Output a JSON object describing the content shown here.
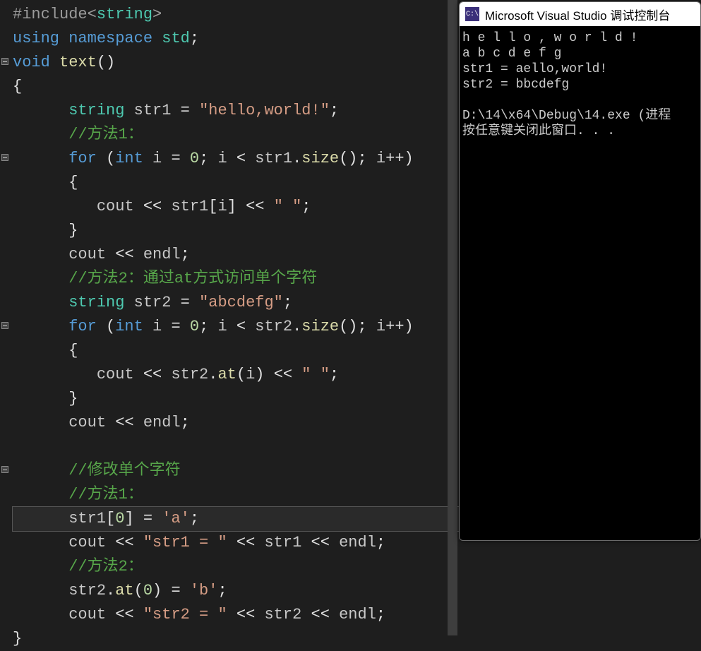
{
  "editor": {
    "lines": [
      {
        "indent": 0,
        "tokens": [
          [
            "pp",
            "#include"
          ],
          [
            "pp",
            "<"
          ],
          [
            "cls",
            "string"
          ],
          [
            "pp",
            ">"
          ]
        ]
      },
      {
        "indent": 0,
        "tokens": [
          [
            "kw",
            "using"
          ],
          [
            "var",
            " "
          ],
          [
            "kw",
            "namespace"
          ],
          [
            "var",
            " "
          ],
          [
            "cls",
            "std"
          ],
          [
            "pun",
            ";"
          ]
        ]
      },
      {
        "indent": 0,
        "fold": true,
        "tokens": [
          [
            "kw",
            "void"
          ],
          [
            "var",
            " "
          ],
          [
            "fn",
            "text"
          ],
          [
            "pun",
            "()"
          ]
        ]
      },
      {
        "indent": 0,
        "tokens": [
          [
            "pun",
            "{"
          ]
        ]
      },
      {
        "indent": 2,
        "tokens": [
          [
            "cls",
            "string"
          ],
          [
            "var",
            " str1 "
          ],
          [
            "pun",
            "= "
          ],
          [
            "str",
            "\"hello,world!\""
          ],
          [
            "pun",
            ";"
          ]
        ]
      },
      {
        "indent": 2,
        "tokens": [
          [
            "cmt",
            "//方法1："
          ]
        ]
      },
      {
        "indent": 2,
        "fold": true,
        "tokens": [
          [
            "kw",
            "for"
          ],
          [
            "pun",
            " ("
          ],
          [
            "kw",
            "int"
          ],
          [
            "var",
            " i "
          ],
          [
            "pun",
            "= "
          ],
          [
            "num",
            "0"
          ],
          [
            "pun",
            "; "
          ],
          [
            "var",
            "i "
          ],
          [
            "pun",
            "< "
          ],
          [
            "var",
            "str1"
          ],
          [
            "pun",
            "."
          ],
          [
            "fn",
            "size"
          ],
          [
            "pun",
            "(); "
          ],
          [
            "var",
            "i"
          ],
          [
            "pun",
            "++)"
          ]
        ]
      },
      {
        "indent": 2,
        "tokens": [
          [
            "pun",
            "{"
          ]
        ]
      },
      {
        "indent": 3,
        "tokens": [
          [
            "var",
            "cout "
          ],
          [
            "pun",
            "<< "
          ],
          [
            "var",
            "str1"
          ],
          [
            "pun",
            "["
          ],
          [
            "var",
            "i"
          ],
          [
            "pun",
            "] "
          ],
          [
            "pun",
            "<< "
          ],
          [
            "str",
            "\" \""
          ],
          [
            "pun",
            ";"
          ]
        ]
      },
      {
        "indent": 2,
        "tokens": [
          [
            "pun",
            "}"
          ]
        ]
      },
      {
        "indent": 2,
        "tokens": [
          [
            "var",
            "cout "
          ],
          [
            "pun",
            "<< "
          ],
          [
            "var",
            "endl"
          ],
          [
            "pun",
            ";"
          ]
        ]
      },
      {
        "indent": 2,
        "tokens": [
          [
            "cmt",
            "//方法2：通过at方式访问单个字符"
          ]
        ]
      },
      {
        "indent": 2,
        "tokens": [
          [
            "cls",
            "string"
          ],
          [
            "var",
            " str2 "
          ],
          [
            "pun",
            "= "
          ],
          [
            "str",
            "\"abcdefg\""
          ],
          [
            "pun",
            ";"
          ]
        ]
      },
      {
        "indent": 2,
        "fold": true,
        "tokens": [
          [
            "kw",
            "for"
          ],
          [
            "pun",
            " ("
          ],
          [
            "kw",
            "int"
          ],
          [
            "var",
            " i "
          ],
          [
            "pun",
            "= "
          ],
          [
            "num",
            "0"
          ],
          [
            "pun",
            "; "
          ],
          [
            "var",
            "i "
          ],
          [
            "pun",
            "< "
          ],
          [
            "var",
            "str2"
          ],
          [
            "pun",
            "."
          ],
          [
            "fn",
            "size"
          ],
          [
            "pun",
            "(); "
          ],
          [
            "var",
            "i"
          ],
          [
            "pun",
            "++)"
          ]
        ]
      },
      {
        "indent": 2,
        "tokens": [
          [
            "pun",
            "{"
          ]
        ]
      },
      {
        "indent": 3,
        "tokens": [
          [
            "var",
            "cout "
          ],
          [
            "pun",
            "<< "
          ],
          [
            "var",
            "str2"
          ],
          [
            "pun",
            "."
          ],
          [
            "fn",
            "at"
          ],
          [
            "pun",
            "("
          ],
          [
            "var",
            "i"
          ],
          [
            "pun",
            ") "
          ],
          [
            "pun",
            "<< "
          ],
          [
            "str",
            "\" \""
          ],
          [
            "pun",
            ";"
          ]
        ]
      },
      {
        "indent": 2,
        "tokens": [
          [
            "pun",
            "}"
          ]
        ]
      },
      {
        "indent": 2,
        "tokens": [
          [
            "var",
            "cout "
          ],
          [
            "pun",
            "<< "
          ],
          [
            "var",
            "endl"
          ],
          [
            "pun",
            ";"
          ]
        ]
      },
      {
        "indent": 0,
        "tokens": []
      },
      {
        "indent": 2,
        "fold": true,
        "tokens": [
          [
            "cmt",
            "//修改单个字符"
          ]
        ]
      },
      {
        "indent": 2,
        "tokens": [
          [
            "cmt",
            "//方法1："
          ]
        ]
      },
      {
        "indent": 2,
        "hl": true,
        "tokens": [
          [
            "var",
            "str1"
          ],
          [
            "pun",
            "["
          ],
          [
            "num",
            "0"
          ],
          [
            "pun",
            "] "
          ],
          [
            "pun",
            "= "
          ],
          [
            "str",
            "'a'"
          ],
          [
            "pun",
            ";"
          ]
        ]
      },
      {
        "indent": 2,
        "tokens": [
          [
            "var",
            "cout "
          ],
          [
            "pun",
            "<< "
          ],
          [
            "str",
            "\"str1 = \""
          ],
          [
            "pun",
            " << "
          ],
          [
            "var",
            "str1"
          ],
          [
            "pun",
            " << "
          ],
          [
            "var",
            "endl"
          ],
          [
            "pun",
            ";"
          ]
        ]
      },
      {
        "indent": 2,
        "tokens": [
          [
            "cmt",
            "//方法2："
          ]
        ]
      },
      {
        "indent": 2,
        "tokens": [
          [
            "var",
            "str2"
          ],
          [
            "pun",
            "."
          ],
          [
            "fn",
            "at"
          ],
          [
            "pun",
            "("
          ],
          [
            "num",
            "0"
          ],
          [
            "pun",
            ") "
          ],
          [
            "pun",
            "= "
          ],
          [
            "str",
            "'b'"
          ],
          [
            "pun",
            ";"
          ]
        ]
      },
      {
        "indent": 2,
        "tokens": [
          [
            "var",
            "cout "
          ],
          [
            "pun",
            "<< "
          ],
          [
            "str",
            "\"str2 = \""
          ],
          [
            "pun",
            " << "
          ],
          [
            "var",
            "str2"
          ],
          [
            "pun",
            " << "
          ],
          [
            "var",
            "endl"
          ],
          [
            "pun",
            ";"
          ]
        ]
      },
      {
        "indent": 0,
        "tokens": [
          [
            "pun",
            "}"
          ]
        ]
      }
    ]
  },
  "console": {
    "title": "Microsoft Visual Studio 调试控制台",
    "icon": "C:\\",
    "out": [
      "h e l l o , w o r l d !",
      "a b c d e f g",
      "str1 = aello,world!",
      "str2 = bbcdefg",
      "",
      "D:\\14\\x64\\Debug\\14.exe (进程",
      "按任意键关闭此窗口. . ."
    ]
  }
}
